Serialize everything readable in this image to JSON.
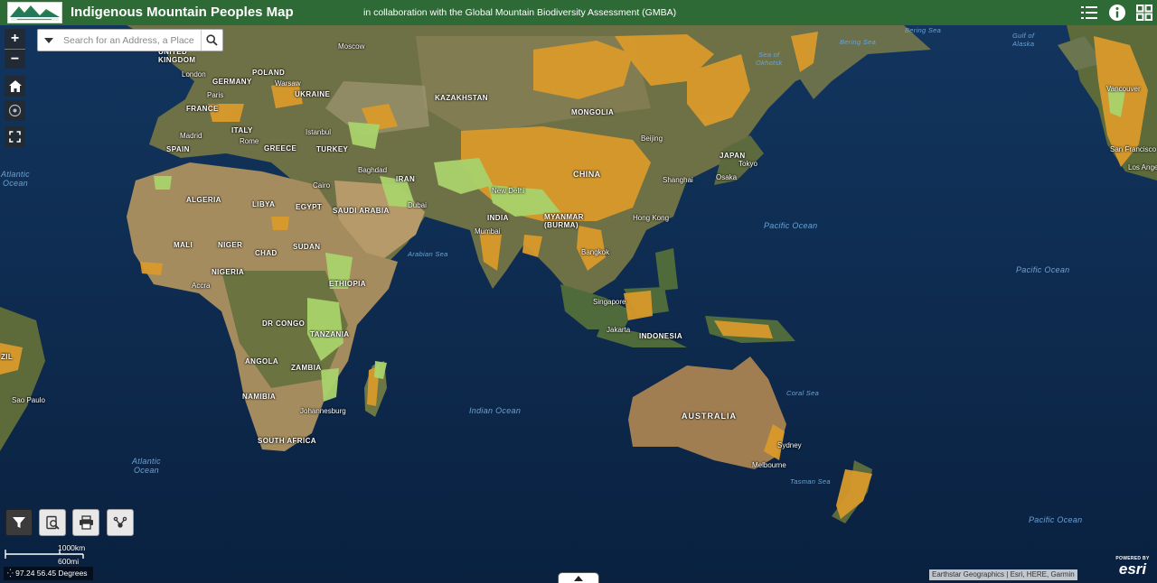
{
  "header": {
    "title": "Indigenous Mountain Peoples Map",
    "subtitle": "in collaboration with the Global Mountain Biodiversity Assessment (GMBA)",
    "logo_icon": "mountain-partnership-logo-icon",
    "legend_icon": "legend-list-icon",
    "about_icon": "info-icon",
    "apps_icon": "grid-apps-icon"
  },
  "colors": {
    "header": "#2d6a35",
    "ocean": "#0d2a4a",
    "land": "#6f7347",
    "mountain_peoples": "#d99a2b",
    "other_mountains": "#a9d36c"
  },
  "search": {
    "placeholder": "Search for an Address, a Place"
  },
  "zoom": {
    "in": "+",
    "out": "−"
  },
  "map_labels": {
    "countries": [
      "UNITED KINGDOM",
      "POLAND",
      "GERMANY",
      "UKRAINE",
      "FRANCE",
      "ITALY",
      "SPAIN",
      "GREECE",
      "TURKEY",
      "KAZAKHSTAN",
      "MONGOLIA",
      "CHINA",
      "JAPAN",
      "IRAN",
      "SAUDI ARABIA",
      "INDIA",
      "MYANMAR (BURMA)",
      "ALGERIA",
      "LIBYA",
      "EGYPT",
      "MALI",
      "NIGER",
      "CHAD",
      "SUDAN",
      "NIGERIA",
      "ETHIOPIA",
      "DR CONGO",
      "TANZANIA",
      "ANGOLA",
      "ZAMBIA",
      "NAMIBIA",
      "SOUTH AFRICA",
      "INDONESIA",
      "AUSTRALIA",
      "ZIL"
    ],
    "cities": [
      "Moscow",
      "London",
      "Paris",
      "Warsaw",
      "Rome",
      "Madrid",
      "Istanbul",
      "Baghdad",
      "Cairo",
      "Dubai",
      "New Delhi",
      "Mumbai",
      "Beijing",
      "Tokyo",
      "Osaka",
      "Shanghai",
      "Hong Kong",
      "Bangkok",
      "Singapore",
      "Jakarta",
      "Accra",
      "Johannesburg",
      "Sydney",
      "Melbourne",
      "Vancouver",
      "San Francisco",
      "Los Angeles",
      "Sao Paulo"
    ],
    "oceans": [
      "Atlantic Ocean",
      "Atlantic Ocean",
      "Arabian Sea",
      "Indian Ocean",
      "Pacific Ocean",
      "Pacific Ocean",
      "Pacific Ocean",
      "Sea of Okhotsk",
      "Bering Sea",
      "Bering Sea",
      "Gulf of Alaska",
      "Coral Sea",
      "Tasman Sea"
    ]
  },
  "tools": {
    "filter_icon": "filter-icon",
    "query_icon": "search-document-icon",
    "print_icon": "print-icon",
    "share_icon": "share-icon"
  },
  "scalebar": {
    "km": "1000km",
    "mi": "600mi"
  },
  "coordinates": "97.24 56.45 Degrees",
  "attribution": "Earthstar Geographics | Esri, HERE, Garmin",
  "esri": {
    "powered": "POWERED BY",
    "name": "esri"
  }
}
